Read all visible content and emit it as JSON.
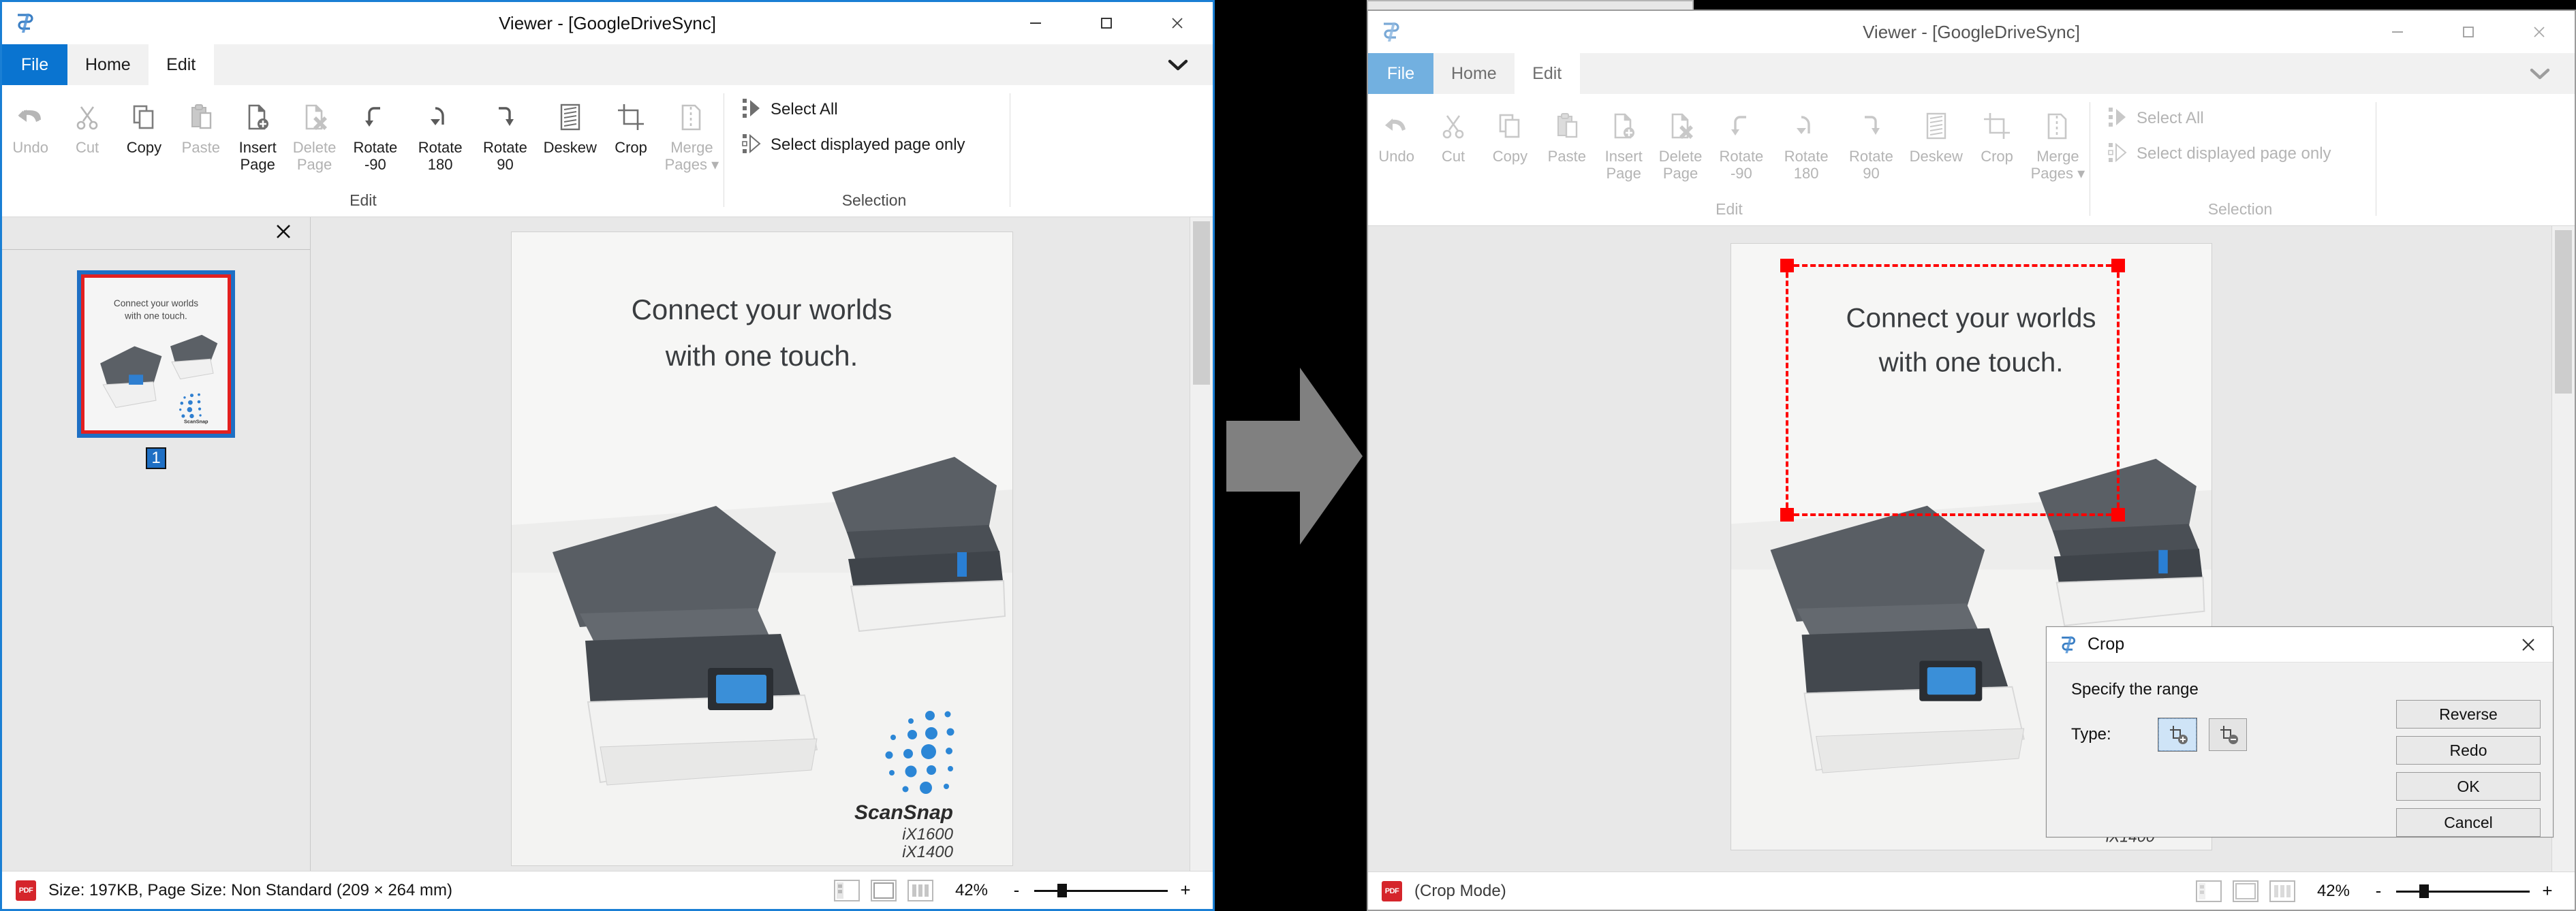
{
  "app": {
    "title": "Viewer - [GoogleDriveSync]",
    "icon": "scansnap-app-icon"
  },
  "window_controls": {
    "minimize": "minimize-icon",
    "maximize": "maximize-icon",
    "close": "close-icon"
  },
  "tabs": [
    {
      "label": "File",
      "state": "file"
    },
    {
      "label": "Home",
      "state": "normal"
    },
    {
      "label": "Edit",
      "state": "active"
    }
  ],
  "ribbon": {
    "collapse_chevron": "chevron-down-icon",
    "groups": [
      {
        "label": "Edit",
        "buttons": [
          {
            "label": "Undo",
            "icon": "undo-arrow-icon",
            "disabled": true
          },
          {
            "label": "Cut",
            "icon": "scissors-icon",
            "disabled": true
          },
          {
            "label": "Copy",
            "icon": "copy-pages-icon",
            "disabled": false
          },
          {
            "label": "Paste",
            "icon": "clipboard-icon",
            "disabled": true
          },
          {
            "label": "Insert\nPage",
            "icon": "insert-page-icon",
            "disabled": false
          },
          {
            "label": "Delete\nPage",
            "icon": "delete-page-icon",
            "disabled": true
          },
          {
            "label": "Rotate\n-90",
            "icon": "rotate-left-icon",
            "disabled": false
          },
          {
            "label": "Rotate\n180",
            "icon": "rotate-180-icon",
            "disabled": false
          },
          {
            "label": "Rotate\n90",
            "icon": "rotate-right-icon",
            "disabled": false
          },
          {
            "label": "Deskew",
            "icon": "deskew-icon",
            "disabled": false
          },
          {
            "label": "Crop",
            "icon": "crop-icon",
            "disabled": false
          },
          {
            "label": "Merge\nPages ▾",
            "icon": "merge-pages-icon",
            "disabled": true
          }
        ]
      },
      {
        "label": "Selection",
        "rows": [
          {
            "label": "Select All",
            "icon": "select-all-icon",
            "disabled": false
          },
          {
            "label": "Select displayed page only",
            "icon": "select-displayed-page-icon",
            "disabled": false
          }
        ]
      }
    ]
  },
  "thumbnails": {
    "close_icon": "close-panel-icon",
    "pages": [
      {
        "number": "1",
        "selected": true
      }
    ]
  },
  "document": {
    "headline_line1": "Connect your worlds",
    "headline_line2": "with one touch.",
    "brand": "ScanSnap",
    "model1": "iX1600",
    "model2": "iX1400"
  },
  "left_status": {
    "file_icon": "pdf-icon",
    "text": "Size: 197KB, Page Size: Non Standard (209 × 264 mm)",
    "view_modes": [
      {
        "name": "view-mode-thumbnail-pane",
        "label": ""
      },
      {
        "name": "view-mode-single-page",
        "label": ""
      },
      {
        "name": "view-mode-continuous",
        "label": ""
      }
    ],
    "zoom_percent": "42%",
    "zoom_out": "-",
    "zoom_in": "+"
  },
  "right_status": {
    "file_icon": "pdf-icon",
    "text": "(Crop Mode)",
    "zoom_percent": "42%",
    "zoom_out": "-",
    "zoom_in": "+"
  },
  "crop_selection": {
    "color": "#ff0000",
    "style": "dashed"
  },
  "transition_arrow": {
    "name": "right-arrow-icon",
    "color": "#808080"
  },
  "crop_dialog": {
    "icon": "scansnap-app-icon",
    "title": "Crop",
    "close": "close-icon",
    "hint": "Specify the range",
    "type_label": "Type:",
    "type_options": [
      {
        "name": "crop-keep-inside",
        "icon": "crop-add-icon",
        "selected": true
      },
      {
        "name": "crop-remove-inside",
        "icon": "crop-subtract-icon",
        "selected": false
      }
    ],
    "buttons": [
      {
        "label": "Reverse"
      },
      {
        "label": "Redo"
      },
      {
        "label": "OK"
      },
      {
        "label": "Cancel"
      }
    ]
  },
  "colors": {
    "accent_blue": "#0a74d0",
    "inactive_blue": "#72b0e0",
    "crop_red": "#ff0000",
    "pdf_red": "#d5252b",
    "selection_blue": "#1e6fc4"
  }
}
